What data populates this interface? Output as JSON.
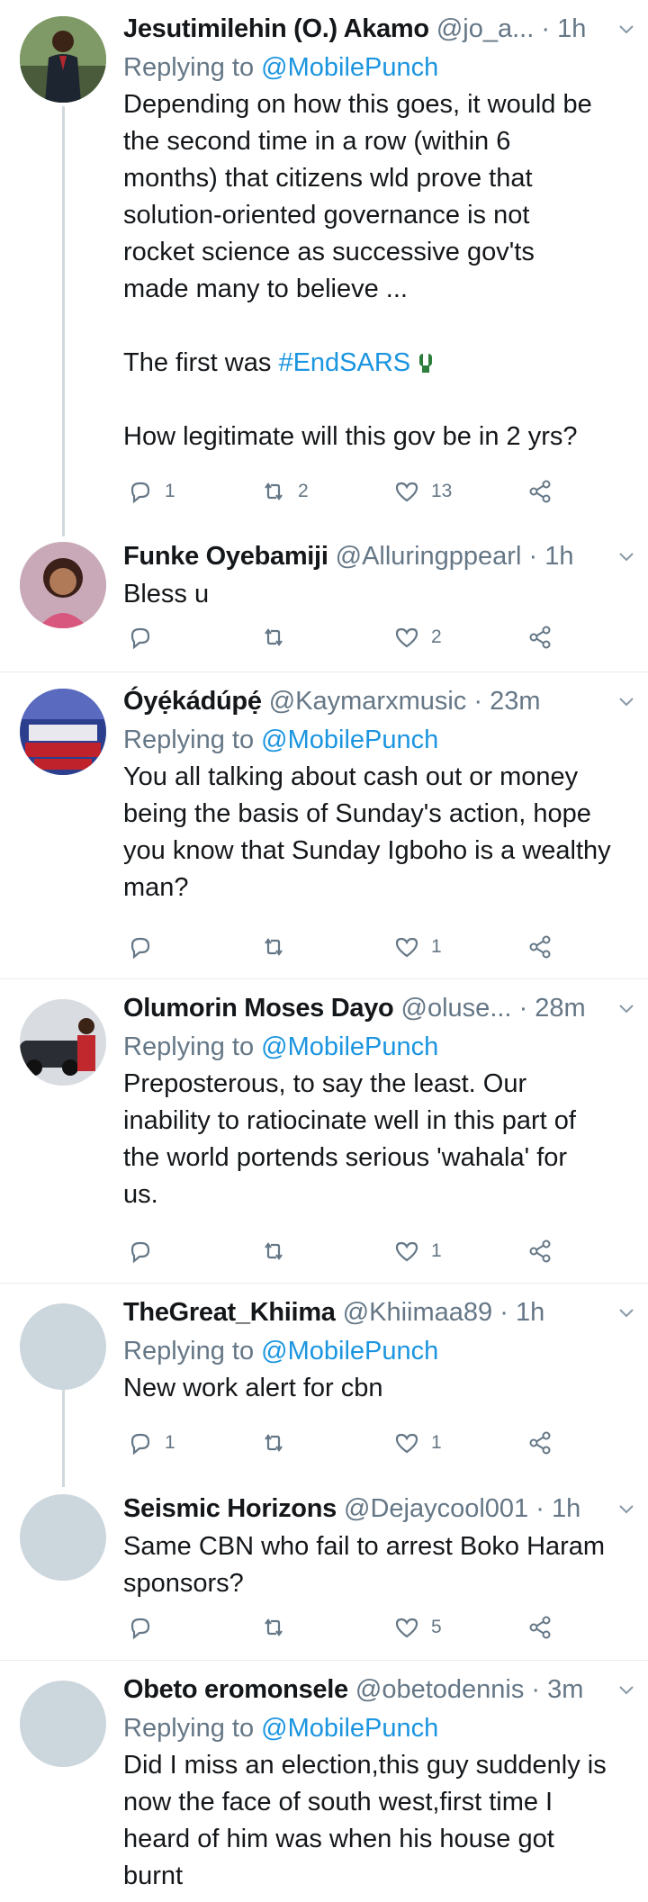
{
  "tweets": [
    {
      "name": "Jesutimilehin (O.) Akamo",
      "handle": "@jo_a...",
      "time": "1h",
      "replying_label": "Replying to",
      "replying_to": "@MobilePunch",
      "lines": [
        "Depending on how this goes, it would be",
        "the second time in a row (within 6",
        "months) that citizens wld prove that",
        "solution-oriented governance is not",
        "rocket science as successive gov'ts",
        "made many to believe ..."
      ],
      "line2_prefix": "The first was ",
      "hashtag": "#EndSARS",
      "line3": "How legitimate will this gov be in 2 yrs?",
      "replies": "1",
      "retweets": "2",
      "likes": "13"
    },
    {
      "name": "Funke Oyebamiji",
      "handle": "@Alluringppearl",
      "time": "1h",
      "text": "Bless u",
      "replies": "",
      "retweets": "",
      "likes": "2"
    },
    {
      "name": "Óyẹ́kádúpẹ́",
      "handle": "@Kaymarxmusic",
      "time": "23m",
      "replying_label": "Replying to",
      "replying_to": "@MobilePunch",
      "text": "You all talking about cash out or money\nbeing the basis of Sunday's action, hope\nyou know that Sunday Igboho is a wealthy\nman?",
      "replies": "",
      "retweets": "",
      "likes": "1"
    },
    {
      "name": "Olumorin Moses Dayo",
      "handle": "@oluse...",
      "time": "28m",
      "replying_label": "Replying to",
      "replying_to": "@MobilePunch",
      "text": "Preposterous, to say the least. Our\ninability to ratiocinate well in this part of\nthe world portends serious 'wahala' for\nus.",
      "replies": "",
      "retweets": "",
      "likes": "1"
    },
    {
      "name": "TheGreat_Khiima",
      "handle": "@Khiimaa89",
      "time": "1h",
      "replying_label": "Replying to",
      "replying_to": "@MobilePunch",
      "text": "New work alert for cbn",
      "replies": "1",
      "retweets": "",
      "likes": "1"
    },
    {
      "name": "Seismic Horizons",
      "handle": "@Dejaycool001",
      "time": "1h",
      "text": "Same CBN who fail to arrest Boko Haram\nsponsors?",
      "replies": "",
      "retweets": "",
      "likes": "5"
    },
    {
      "name": "Obeto eromonsele",
      "handle": "@obetodennis",
      "time": "3m",
      "replying_label": "Replying to",
      "replying_to": "@MobilePunch",
      "text": "Did I miss an election,this guy suddenly is\nnow the face of south west,first time I\nheard of him was when his house got\nburnt",
      "replies": "",
      "retweets": "",
      "likes": ""
    }
  ],
  "icons": {
    "reply": "reply-icon",
    "retweet": "retweet-icon",
    "like": "heart-icon",
    "share": "share-icon",
    "more": "chevron-down-icon"
  },
  "colors": {
    "link": "#1b95e0",
    "secondary": "#657786",
    "divider": "#e6ecf0",
    "thread_line": "#cfd9de"
  }
}
